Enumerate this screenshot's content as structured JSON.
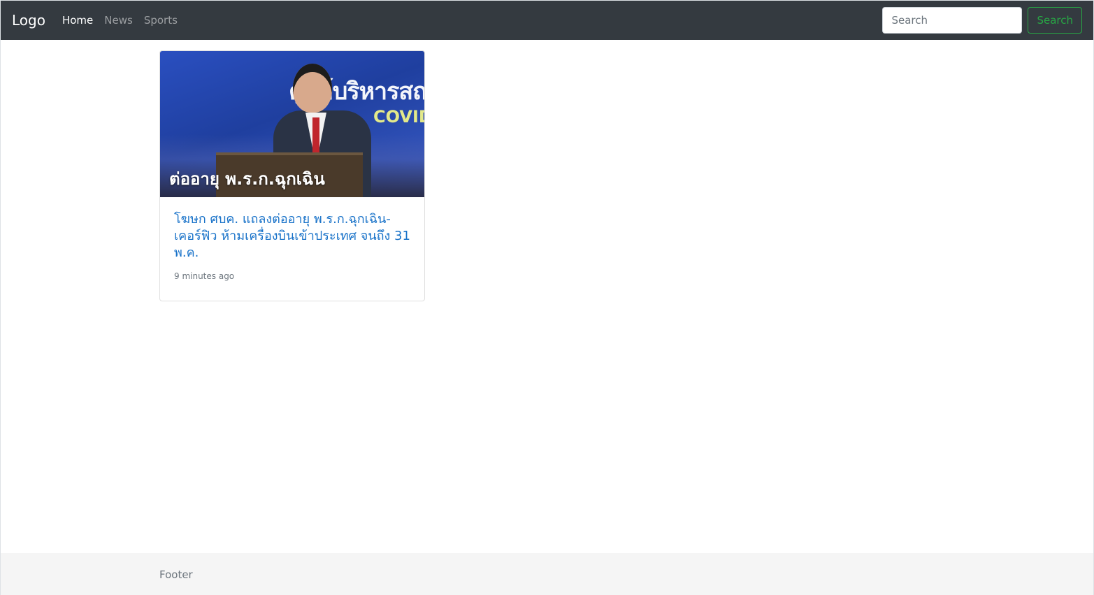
{
  "navbar": {
    "brand": "Logo",
    "links": [
      {
        "label": "Home",
        "active": true
      },
      {
        "label": "News",
        "active": false
      },
      {
        "label": "Sports",
        "active": false
      }
    ],
    "search_placeholder": "Search",
    "search_button": "Search",
    "background": "#343a40",
    "accent": "#28a745"
  },
  "card": {
    "image": {
      "banner_text": "ศูนย์บริหารสถ",
      "banner_sub": "COVID",
      "overlay_text": "ต่ออายุ พ.ร.ก.ฉุกเฉิน"
    },
    "title": "โฆษก ศบค. แถลงต่ออายุ พ.ร.ก.ฉุกเฉิน-เคอร์ฟิว ห้ามเครื่องบินเข้าประเทศ จนถึง 31 พ.ค.",
    "time": "9 minutes ago",
    "title_color": "#1a73c9"
  },
  "footer": {
    "text": "Footer"
  }
}
